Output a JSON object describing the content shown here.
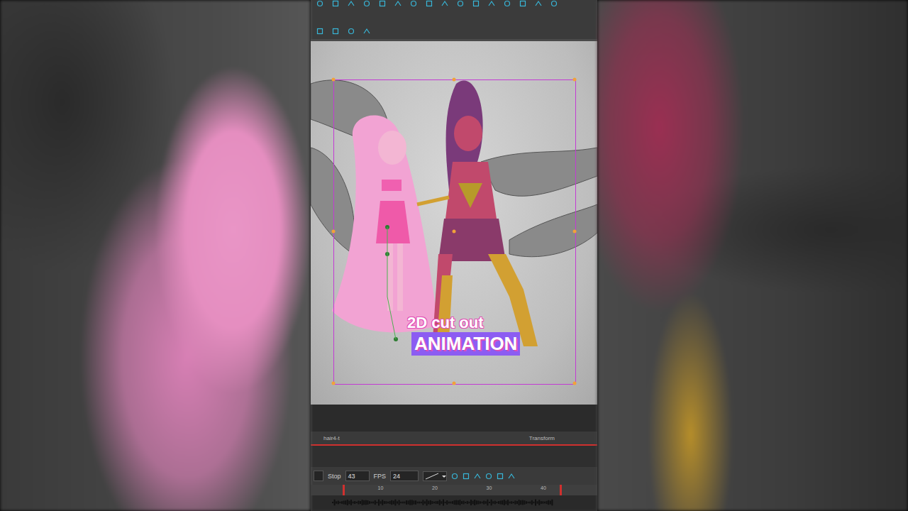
{
  "caption": {
    "line1": "2D cut out",
    "line2": "ANIMATION"
  },
  "timeline": {
    "layer": "hair4-t",
    "panel": "Transform",
    "stop_label": "Stop",
    "stop": "43",
    "fps_label": "FPS",
    "fps": "24",
    "ruler": [
      "10",
      "20",
      "30",
      "40"
    ],
    "playhead": {
      "level": 0.07
    }
  }
}
